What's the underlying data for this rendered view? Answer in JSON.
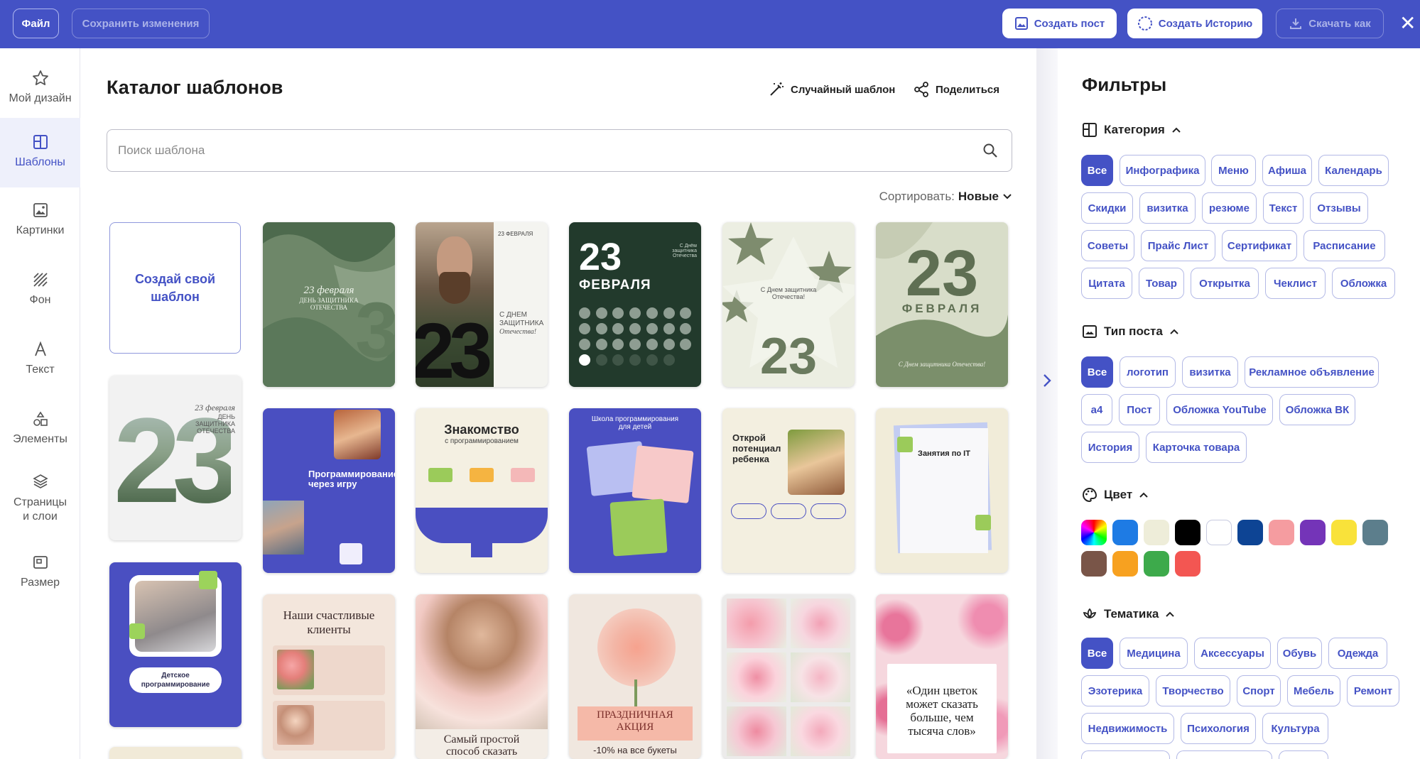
{
  "topbar": {
    "file_label": "Файл",
    "save_label": "Сохранить изменения",
    "create_post_label": "Создать пост",
    "create_story_label": "Создать Историю",
    "download_label": "Скачать как",
    "close_label": "✕"
  },
  "sidebar": {
    "items": [
      {
        "label": "Мой дизайн",
        "icon": "star-icon"
      },
      {
        "label": "Шаблоны",
        "icon": "layout-icon"
      },
      {
        "label": "Картинки",
        "icon": "image-icon"
      },
      {
        "label": "Фон",
        "icon": "hatch-icon"
      },
      {
        "label": "Текст",
        "icon": "text-icon"
      },
      {
        "label": "Элементы",
        "icon": "shapes-icon"
      },
      {
        "label": "Страницы\nи слои",
        "icon": "layers-icon"
      },
      {
        "label": "Размер",
        "icon": "resize-icon"
      }
    ]
  },
  "main": {
    "title": "Каталог шаблонов",
    "random_label": "Случайный шаблон",
    "share_label": "Поделиться",
    "search_placeholder": "Поиск шаблона",
    "sort_label": "Сортировать:",
    "sort_value": "Новые",
    "create_card_label": "Создай свой шаблон",
    "templates": [
      {
        "lines": [
          "23 февраля",
          "ДЕНЬ ЗАЩИТНИКА",
          "ОТЕЧЕСТВА"
        ]
      },
      {
        "lines": [
          "23 ФЕВРАЛЯ",
          "С ДНЕМ",
          "ЗАЩИТНИКА",
          "Отечества!"
        ]
      },
      {
        "lines": [
          "23",
          "ФЕВРАЛЯ",
          "С Днём защитника Отечества"
        ]
      },
      {
        "lines": [
          "С Днем защитника",
          "Отечества!",
          "23"
        ]
      },
      {
        "lines": [
          "23",
          "ФЕВРАЛЯ",
          "С Днем защитника Отечества!"
        ]
      },
      {
        "lines": [
          "23 февраля",
          "ДЕНЬ ЗАЩИТНИКА",
          "ОТЕЧЕСТВА"
        ]
      },
      {
        "lines": [
          "Программирование",
          "через игру"
        ]
      },
      {
        "lines": [
          "Знакомство",
          "с программированием"
        ]
      },
      {
        "lines": [
          "Школа программирования",
          "для детей"
        ]
      },
      {
        "lines": [
          "Открой",
          "потенциал",
          "ребенка"
        ]
      },
      {
        "lines": [
          "Занятия по IT"
        ]
      },
      {
        "lines": [
          "Детское",
          "программирование"
        ]
      },
      {
        "lines": [
          "Наши счастливые",
          "клиенты"
        ]
      },
      {
        "lines": [
          "Самый простой",
          "способ сказать"
        ]
      },
      {
        "lines": [
          "ПРАЗДНИЧНАЯ",
          "АКЦИЯ",
          "-10% на все букеты"
        ]
      },
      {
        "lines": []
      },
      {
        "lines": [
          "«Один цветок",
          "может сказать",
          "больше, чем",
          "тысяча слов»"
        ]
      }
    ]
  },
  "filters": {
    "title": "Фильтры",
    "category": {
      "label": "Категория",
      "chips": [
        "Все",
        "Инфографика",
        "Меню",
        "Афиша",
        "Календарь",
        "Скидки",
        "визитка",
        "резюме",
        "Текст",
        "Отзывы",
        "Советы",
        "Прайс Лист",
        "Сертификат",
        "Расписание",
        "Цитата",
        "Товар",
        "Открытка",
        "Чеклист",
        "Обложка"
      ]
    },
    "post_type": {
      "label": "Тип поста",
      "chips": [
        "Все",
        "логотип",
        "визитка",
        "Рекламное объявление",
        "а4",
        "Пост",
        "Обложка YouTube",
        "Обложка ВК",
        "История",
        "Карточка товара"
      ]
    },
    "color": {
      "label": "Цвет",
      "swatches": [
        "rainbow",
        "#1e7be4",
        "#eeedd9",
        "#000000",
        "#ffffff",
        "#0d4494",
        "#f59ca0",
        "#7434b8",
        "#f9e23a",
        "#5c7e8c",
        "#795548",
        "#f7a120",
        "#3daa4b",
        "#f35652"
      ]
    },
    "theme": {
      "label": "Тематика",
      "chips": [
        "Все",
        "Медицина",
        "Аксессуары",
        "Обувь",
        "Одежда",
        "Эзотерика",
        "Творчество",
        "Спорт",
        "Мебель",
        "Ремонт",
        "Недвижимость",
        "Психология",
        "Культура"
      ]
    }
  }
}
